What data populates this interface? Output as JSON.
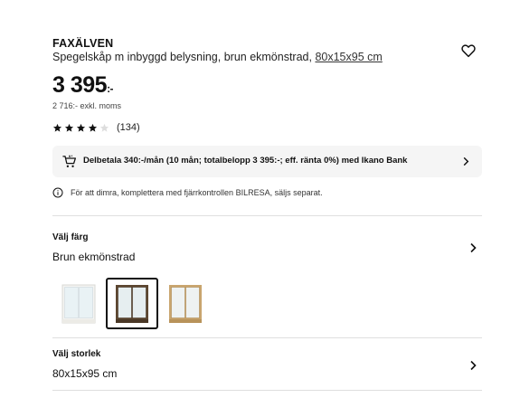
{
  "product": {
    "name": "FAXÄLVEN",
    "description": "Spegelskåp m inbyggd belysning, brun ekmönstrad, ",
    "size_link": "80x15x95 cm",
    "price_main": "3 395",
    "price_suffix": ":-",
    "price_excl": "2 716:- exkl. moms",
    "rating_stars": 4,
    "rating_max": 5,
    "rating_count": "(134)"
  },
  "finance": {
    "text": "Delbetala 340:-/mån (10 mån; totalbelopp 3 395:-; eff. ränta 0%) med Ikano Bank"
  },
  "info": {
    "text": "För att dimra, komplettera med fjärrkontrollen BILRESA, säljs separat."
  },
  "color_section": {
    "title": "Välj färg",
    "value": "Brun ekmönstrad",
    "options": [
      {
        "name": "white",
        "frame": "#f4f4f2",
        "selected": false
      },
      {
        "name": "brown-oak",
        "frame": "#5c4630",
        "selected": true
      },
      {
        "name": "light-oak",
        "frame": "#c9a56e",
        "selected": false
      }
    ]
  },
  "size_section": {
    "title": "Välj storlek",
    "value": "80x15x95 cm"
  },
  "colors": {
    "text": "#111111",
    "finance_bg": "#f5f5f5",
    "divider": "#dfdfdf"
  }
}
